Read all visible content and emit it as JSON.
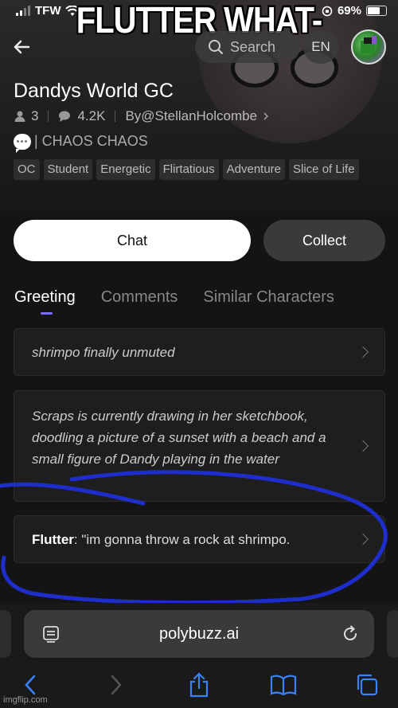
{
  "overlay_caption": "FLUTTER WHAT-",
  "status_bar": {
    "carrier": "TFW",
    "battery_percent": "69%",
    "battery_level": 0.69
  },
  "header": {
    "search_placeholder": "Search",
    "language": "EN"
  },
  "character": {
    "name": "Dandys World GC",
    "followers": "3",
    "chats": "4.2K",
    "creator": "By@StellanHolcombe",
    "description": "| CHAOS CHAOS"
  },
  "tags": [
    "OC",
    "Student",
    "Energetic",
    "Flirtatious",
    "Adventure",
    "Slice of Life"
  ],
  "actions": {
    "chat": "Chat",
    "collect": "Collect"
  },
  "tabs": [
    {
      "label": "Greeting",
      "active": true
    },
    {
      "label": "Comments",
      "active": false
    },
    {
      "label": "Similar Characters",
      "active": false
    }
  ],
  "greetings": [
    {
      "text": "shrimpo finally unmuted"
    },
    {
      "text": "Scraps is currently drawing in her sketchbook, doodling a picture of a sunset with a beach and a small figure of Dandy playing in the water"
    },
    {
      "speaker": "Flutter",
      "text": ": \"im gonna throw a rock at shrimpo."
    }
  ],
  "browser": {
    "url": "polybuzz.ai"
  },
  "watermark": "imgflip.com",
  "colors": {
    "accent": "#7c6cff",
    "scribble": "#1f2fd6",
    "background": "#141414"
  }
}
